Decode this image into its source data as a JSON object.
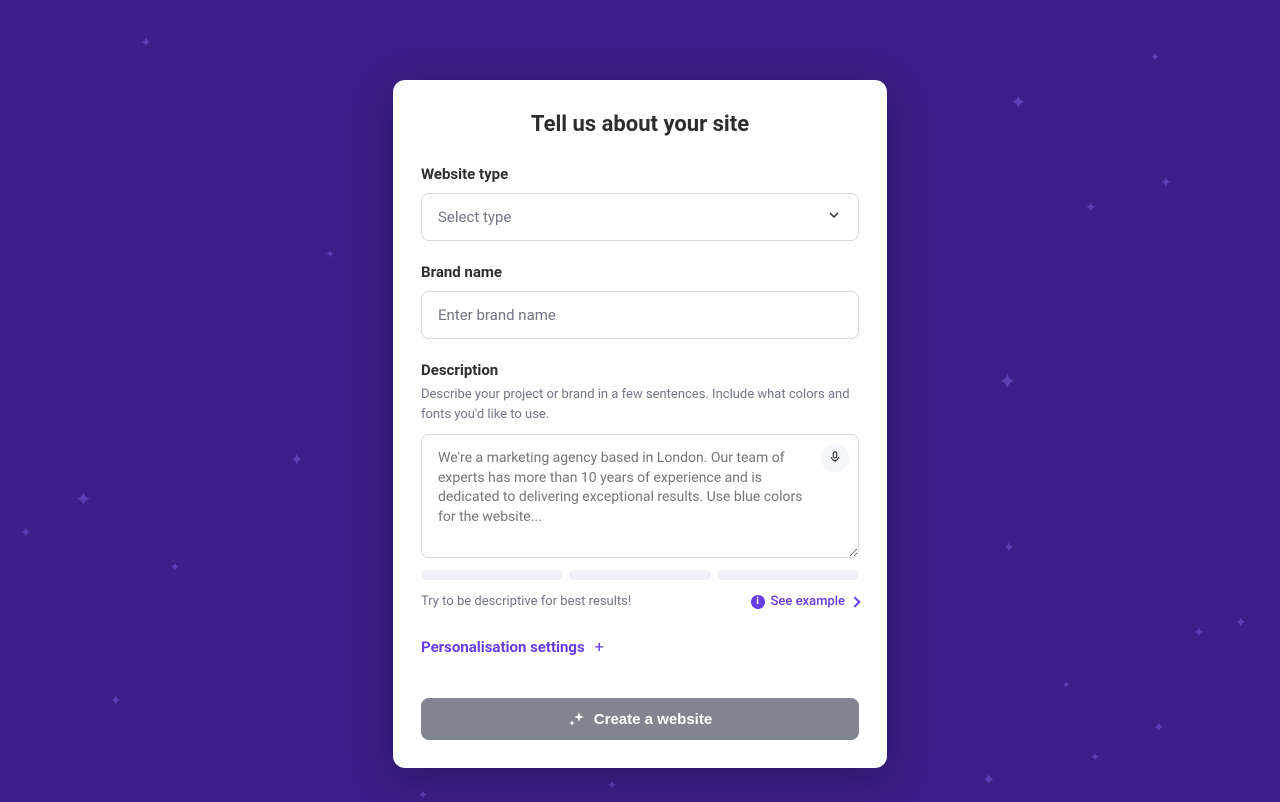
{
  "form": {
    "title": "Tell us about your site",
    "website_type": {
      "label": "Website type",
      "placeholder": "Select type"
    },
    "brand_name": {
      "label": "Brand name",
      "placeholder": "Enter brand name"
    },
    "description": {
      "label": "Description",
      "hint": "Describe your project or brand in a few sentences. Include what colors and fonts you'd like to use.",
      "placeholder": "We're a marketing agency based in London. Our team of experts has more than 10 years of experience and is dedicated to delivering exceptional results. Use blue colors for the website..."
    },
    "help_text": "Try to be descriptive for best results!",
    "see_example": "See example",
    "personalisation": "Personalisation settings",
    "submit": "Create a website"
  }
}
